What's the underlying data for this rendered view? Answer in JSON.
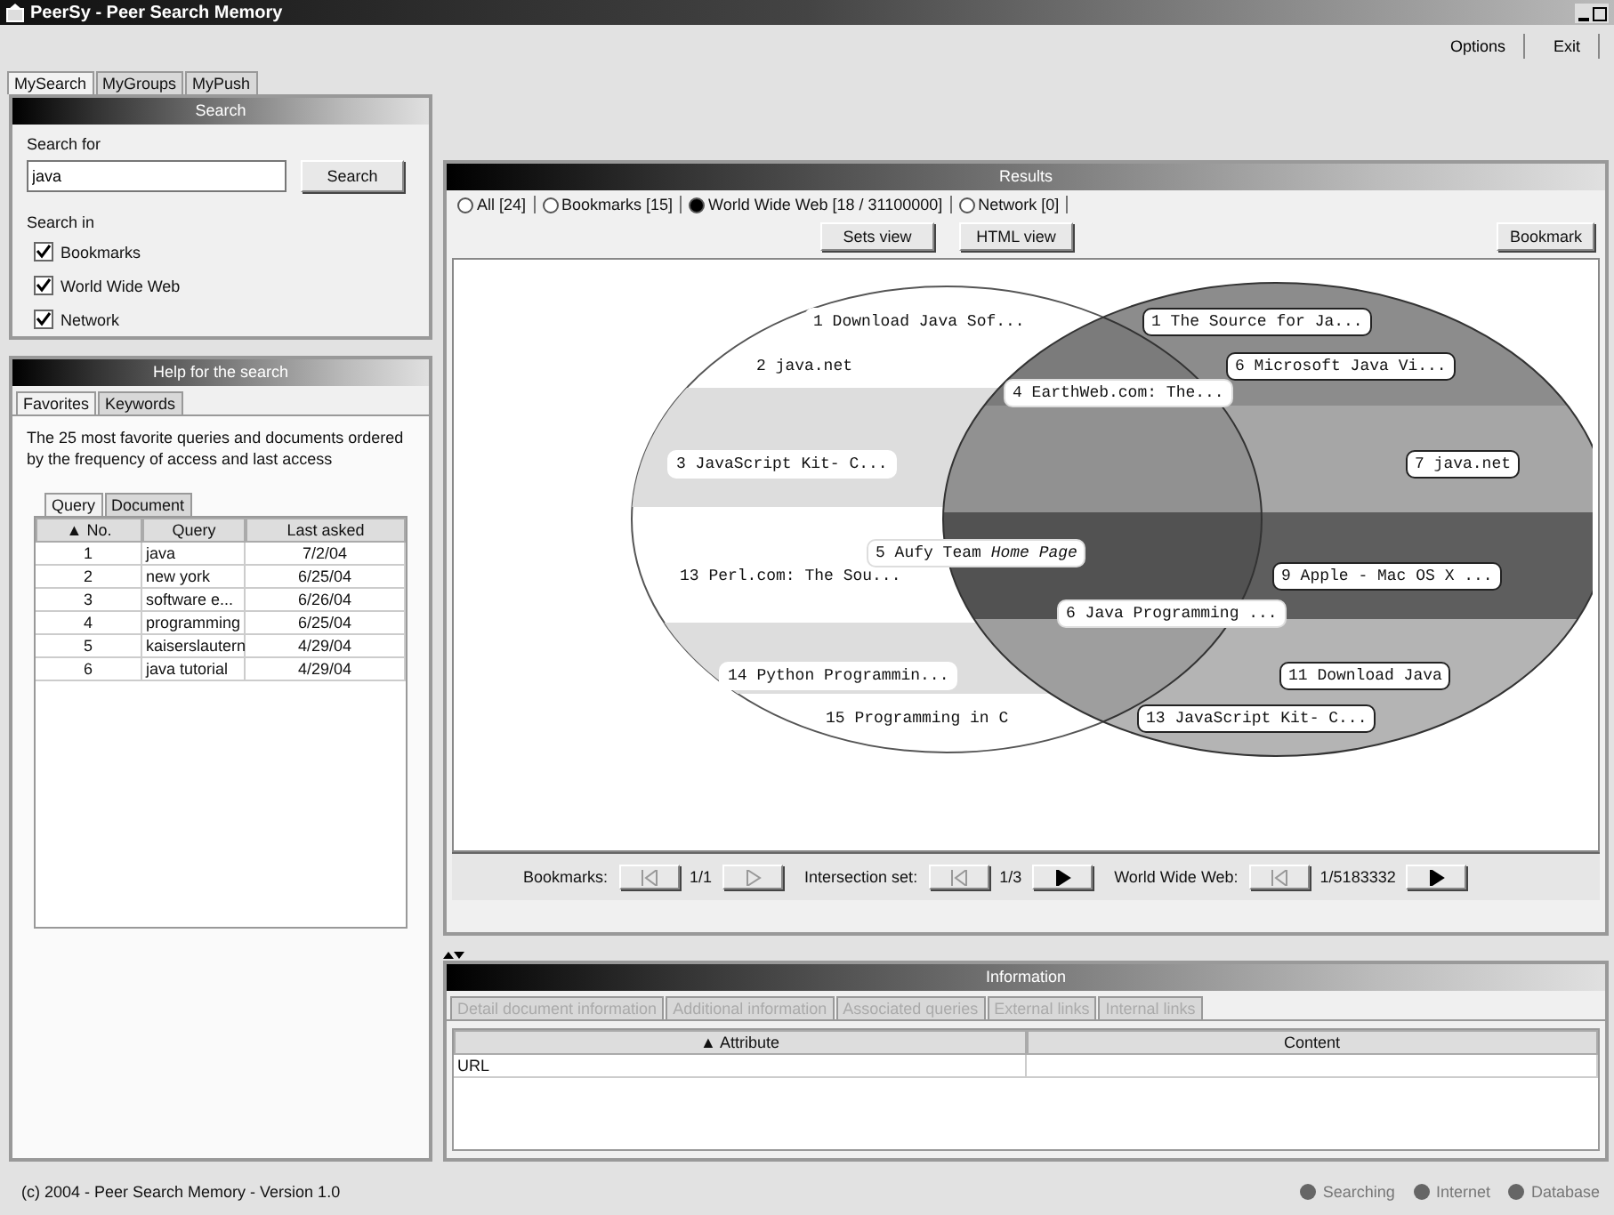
{
  "window": {
    "title": "PeerSy - Peer Search Memory"
  },
  "toolbar": {
    "buttons": [
      "Options",
      "Exit"
    ]
  },
  "main_tabs": [
    {
      "label": "MySearch",
      "selected": true
    },
    {
      "label": "MyGroups",
      "selected": false
    },
    {
      "label": "MyPush",
      "selected": false
    }
  ],
  "search_panel": {
    "title": "Search",
    "search_label": "Search for",
    "query": "java",
    "search_button": "Search",
    "search_in_label": "Search in",
    "sources": [
      {
        "label": "Bookmarks",
        "checked": true
      },
      {
        "label": "World Wide Web",
        "checked": true
      },
      {
        "label": "Network",
        "checked": true
      }
    ]
  },
  "help_panel": {
    "title": "Help for the search",
    "tabs": [
      {
        "label": "Favorites",
        "selected": true
      },
      {
        "label": "Keywords",
        "selected": false
      }
    ],
    "description": "The 25 most favorite queries and documents ordered by the frequency of access and last access",
    "sub_tabs": [
      {
        "label": "Query",
        "selected": true
      },
      {
        "label": "Document",
        "selected": false
      }
    ],
    "table": {
      "columns": [
        "▲ No.",
        "Query",
        "Last asked"
      ],
      "rows": [
        [
          "1",
          "java",
          "7/2/04"
        ],
        [
          "2",
          "new york",
          "6/25/04"
        ],
        [
          "3",
          "software e...",
          "6/26/04"
        ],
        [
          "4",
          "programming",
          "6/25/04"
        ],
        [
          "5",
          "kaiserslautern",
          "4/29/04"
        ],
        [
          "6",
          "java tutorial",
          "4/29/04"
        ]
      ]
    }
  },
  "results_panel": {
    "title": "Results",
    "filters": [
      {
        "label": "All [24]",
        "selected": false
      },
      {
        "label": "Bookmarks [15]",
        "selected": false
      },
      {
        "label": "World Wide Web [18 / 31100000]",
        "selected": true
      },
      {
        "label": "Network [0]",
        "selected": false
      }
    ],
    "view_buttons": [
      "Sets view",
      "HTML view"
    ],
    "bookmark_button": "Bookmark",
    "venn_labels": [
      {
        "text": "1 Download Java Sof...",
        "kind": "bookmarks"
      },
      {
        "text": "2 java.net",
        "kind": "bookmarks"
      },
      {
        "text": "3 JavaScript Kit- C...",
        "kind": "bookmarks"
      },
      {
        "text": "13 Perl.com: The Sou...",
        "kind": "bookmarks"
      },
      {
        "text": "14 Python Programmin...",
        "kind": "bookmarks"
      },
      {
        "text": "15 Programming in C",
        "kind": "bookmarks"
      },
      {
        "text": "4 EarthWeb.com: The...",
        "kind": "intersection"
      },
      {
        "text": "5 Aufy Team *Home Page*",
        "kind": "intersection"
      },
      {
        "text": "6 Java Programming ...",
        "kind": "intersection"
      },
      {
        "text": "1 The Source for Ja...",
        "kind": "web"
      },
      {
        "text": "6 Microsoft Java Vi...",
        "kind": "web"
      },
      {
        "text": "7 java.net",
        "kind": "web"
      },
      {
        "text": "9 Apple - Mac OS X ...",
        "kind": "web"
      },
      {
        "text": "11 Download Java",
        "kind": "web"
      },
      {
        "text": "13 JavaScript Kit- C...",
        "kind": "web"
      }
    ],
    "navigation": [
      {
        "label": "Bookmarks:",
        "position": "1/1",
        "prev_enabled": false,
        "next_enabled": false
      },
      {
        "label": "Intersection set:",
        "position": "1/3",
        "prev_enabled": false,
        "next_enabled": true
      },
      {
        "label": "World Wide Web:",
        "position": "1/5183332",
        "prev_enabled": false,
        "next_enabled": true
      }
    ]
  },
  "information_panel": {
    "title": "Information",
    "tabs": [
      {
        "label": "Detail document information",
        "disabled": true
      },
      {
        "label": "Additional information",
        "disabled": true
      },
      {
        "label": "Associated queries",
        "disabled": true
      },
      {
        "label": "External links",
        "disabled": true
      },
      {
        "label": "Internal links",
        "disabled": true
      }
    ],
    "table": {
      "columns": [
        "▲ Attribute",
        "Content"
      ],
      "rows": [
        [
          "URL",
          ""
        ]
      ]
    }
  },
  "status_bar": {
    "text": "(c) 2004 - Peer Search Memory - Version 1.0",
    "indicators": [
      "Searching",
      "Internet",
      "Database"
    ]
  }
}
